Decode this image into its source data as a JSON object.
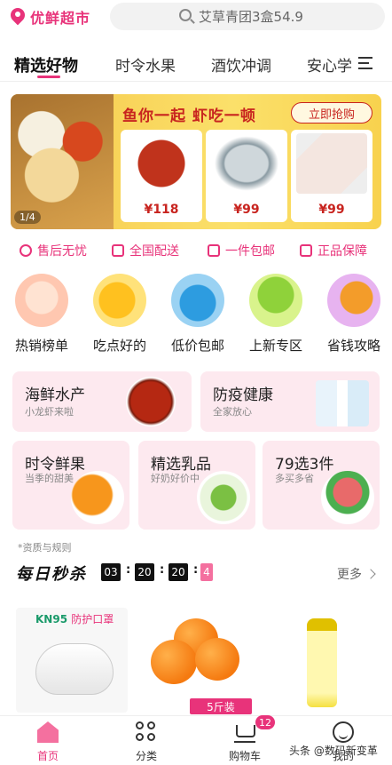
{
  "header": {
    "brand": "优鲜超市",
    "search_placeholder": "艾草青团3盒54.9",
    "icons": {
      "location": "location-pin-icon",
      "search": "search-icon",
      "menu": "menu-icon"
    }
  },
  "tabs": [
    {
      "label": "精选好物",
      "active": true
    },
    {
      "label": "时令水果",
      "active": false
    },
    {
      "label": "酒饮冲调",
      "active": false
    },
    {
      "label": "安心学",
      "active": false
    }
  ],
  "banner": {
    "title": "鱼你一起 虾吃一顿",
    "button": "立即抢购",
    "page_indicator": "1/4",
    "items": [
      {
        "price": "¥118"
      },
      {
        "price": "¥99"
      },
      {
        "price": "¥99"
      }
    ]
  },
  "guarantees": [
    "售后无忧",
    "全国配送",
    "一件包邮",
    "正品保障"
  ],
  "categories": [
    "热销榜单",
    "吃点好的",
    "低价包邮",
    "上新专区",
    "省钱攻略"
  ],
  "promos": {
    "seafood": {
      "title": "海鲜水产",
      "subtitle": "小龙虾来啦"
    },
    "health": {
      "title": "防疫健康",
      "subtitle": "全家放心"
    },
    "fruit": {
      "title": "时令鲜果",
      "subtitle": "当季的甜美"
    },
    "dairy": {
      "title": "精选乳品",
      "subtitle": "好奶好价中"
    },
    "deal3": {
      "title": "79选3件",
      "subtitle": "多买多省"
    }
  },
  "rules_link": "*资质与规则",
  "flash_sale": {
    "title": "每日秒杀",
    "countdown": {
      "hours": "03",
      "minutes": "20",
      "seconds": "20",
      "fraction": "4"
    },
    "more": "更多"
  },
  "deals": {
    "mask_brand": "KN95",
    "mask_label": "防护口罩",
    "orange_tag": "5斤装"
  },
  "bottom_nav": [
    {
      "label": "首页",
      "active": true
    },
    {
      "label": "分类",
      "active": false
    },
    {
      "label": "购物车",
      "active": false
    },
    {
      "label": "我的",
      "active": false
    }
  ],
  "cart_badge": "12",
  "watermark": "头条 @数码新变革",
  "colors": {
    "accent": "#e8337a",
    "banner_red": "#c8241f",
    "promo_bg": "#fde9ef"
  }
}
